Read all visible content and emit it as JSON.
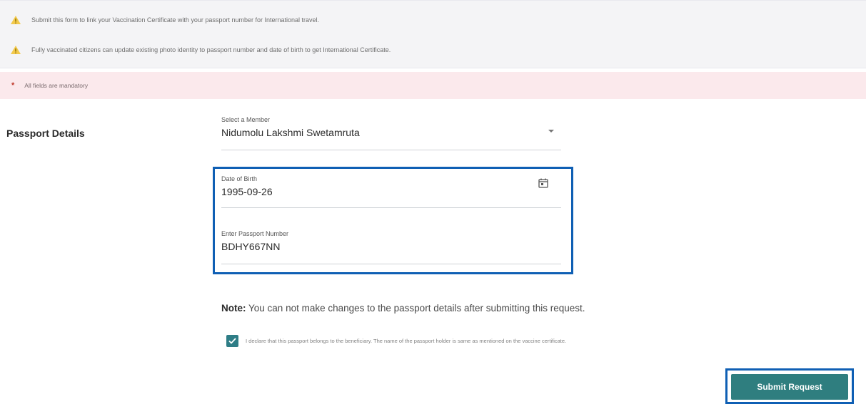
{
  "info": {
    "line1": "Submit this form to link your Vaccination Certificate with your passport number for International travel.",
    "line2": "Fully vaccinated citizens can update existing photo identity to passport number and date of birth to get International Certificate.",
    "warning_icon": "warning-triangle-icon",
    "warning_color": "#f2c94c"
  },
  "mandatory": {
    "marker": "*",
    "text": "All fields are mandatory"
  },
  "section": {
    "label": "Passport Details"
  },
  "fields": {
    "member": {
      "label": "Select a Member",
      "value": "Nidumolu Lakshmi Swetamruta"
    },
    "dob": {
      "label": "Date of Birth",
      "value": "1995-09-26"
    },
    "passport": {
      "label": "Enter Passport Number",
      "value": "BDHY667NN"
    }
  },
  "note": {
    "prefix": "Note:",
    "text": "You can not make changes to the passport details after submitting this request."
  },
  "declaration": {
    "checked": true,
    "text": "I declare that this passport belongs to the beneficiary. The name of the passport holder is same as mentioned on the vaccine certificate."
  },
  "submit": {
    "label": "Submit Request"
  },
  "colors": {
    "accent": "#2f7e7f",
    "highlight": "#0f5fb4",
    "mandatory_bg": "#fbe9ec"
  }
}
